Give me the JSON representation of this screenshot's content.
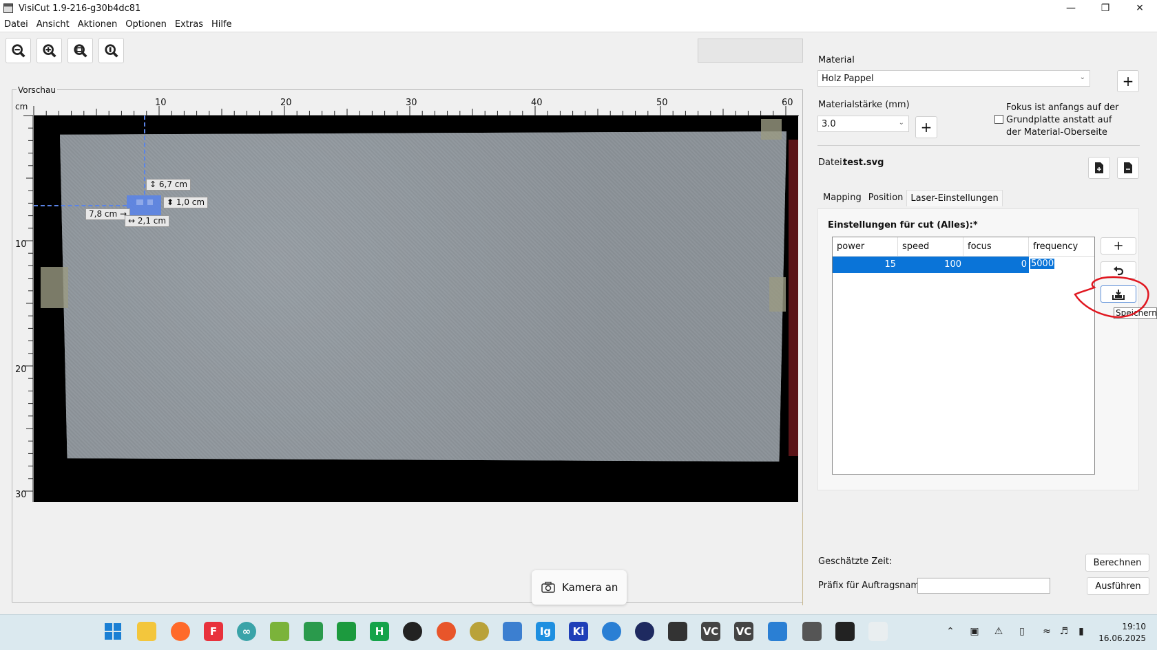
{
  "window": {
    "title": "VisiCut 1.9-216-g30b4dc81",
    "minimize": "—",
    "maximize": "❐",
    "close": "✕"
  },
  "menu": [
    "Datei",
    "Ansicht",
    "Aktionen",
    "Optionen",
    "Extras",
    "Hilfe"
  ],
  "toolbar": {
    "icons": [
      "zoom-out-icon",
      "zoom-in-icon",
      "zoom-fit-icon",
      "zoom-actual-icon"
    ]
  },
  "preview": {
    "legend": "Vorschau",
    "unit": "cm",
    "x_ticks": [
      "10",
      "20",
      "30",
      "40",
      "50",
      "60"
    ],
    "y_ticks": [
      "10",
      "20",
      "30"
    ],
    "dim_labels": {
      "top": "↕ 6,7 cm",
      "height": "⬍ 1,0 cm",
      "left": "7,8 cm →",
      "width": "↔ 2,1 cm"
    }
  },
  "camera": {
    "label": "Kamera an",
    "icon": "camera-icon"
  },
  "right_panel": {
    "material_label": "Material",
    "material_value": "Holz Pappel",
    "thickness_label": "Materialstärke (mm)",
    "thickness_value": "3.0",
    "focus_checkbox_label": "Fokus ist anfangs auf der Grundplatte anstatt auf der Material-Oberseite",
    "file_label": "Datei:",
    "file_name": "test.svg",
    "tabs": [
      "Mapping",
      "Position",
      "Laser-Einstellungen"
    ],
    "settings_title": "Einstellungen für cut (Alles):*",
    "table": {
      "headers": [
        "power",
        "speed",
        "focus",
        "frequency"
      ],
      "rows": [
        [
          "15",
          "100",
          "0",
          "5000"
        ]
      ]
    },
    "tooltip": "Speichern",
    "estimated_time_label": "Geschätzte Zeit:",
    "calculate_button": "Berechnen",
    "prefix_label": "Präfix für Auftragsname:",
    "prefix_value": "",
    "execute_button": "Ausführen"
  },
  "taskbar": {
    "time": "19:10",
    "date": "16.06.2025"
  }
}
